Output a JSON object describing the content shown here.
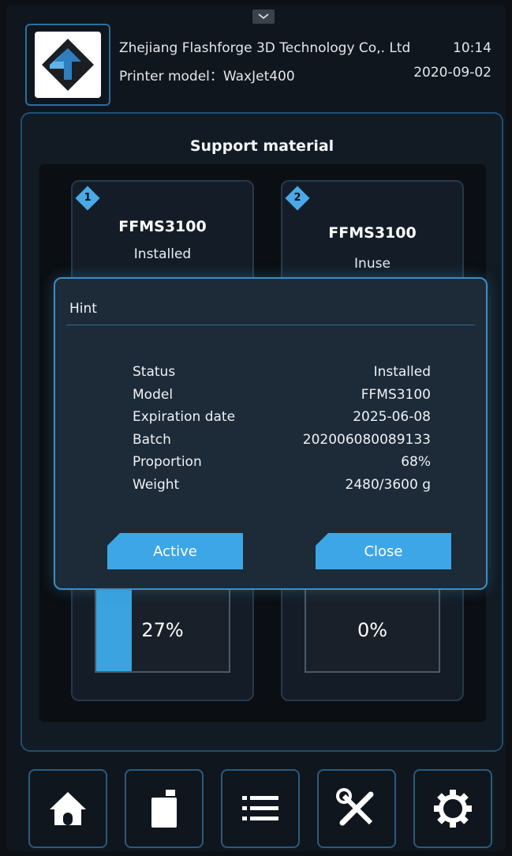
{
  "header": {
    "company": "Zhejiang Flashforge 3D Technology Co,. Ltd",
    "model_line": "Printer model：WaxJet400",
    "time": "10:14",
    "date": "2020-09-02",
    "logo_icon": "flashforge-logo-icon",
    "pull_tab_icon": "chevron-down-icon"
  },
  "panel": {
    "title": "Support material",
    "slots": [
      {
        "number": "1",
        "model": "FFMS3100",
        "status": "Installed",
        "fill_percent": 27,
        "fill_label": "27%"
      },
      {
        "number": "2",
        "model": "FFMS3100",
        "status": "Inuse",
        "fill_percent": 0,
        "fill_label": "0%"
      }
    ]
  },
  "dialog": {
    "title": "Hint",
    "rows": [
      {
        "label": "Status",
        "value": "Installed"
      },
      {
        "label": "Model",
        "value": "FFMS3100"
      },
      {
        "label": "Expiration date",
        "value": "2025-06-08"
      },
      {
        "label": "Batch",
        "value": "202006080089133"
      },
      {
        "label": "Proportion",
        "value": "68%"
      },
      {
        "label": "Weight",
        "value": "2480/3600 g"
      }
    ],
    "active_label": "Active",
    "close_label": "Close"
  },
  "nav": [
    {
      "name": "home",
      "icon": "home-icon"
    },
    {
      "name": "material",
      "icon": "bottle-icon"
    },
    {
      "name": "list",
      "icon": "list-icon"
    },
    {
      "name": "tools",
      "icon": "tools-icon"
    },
    {
      "name": "settings",
      "icon": "gear-icon"
    }
  ],
  "colors": {
    "accent": "#3da6e6",
    "background": "#10161d",
    "border": "#2a5b80"
  }
}
